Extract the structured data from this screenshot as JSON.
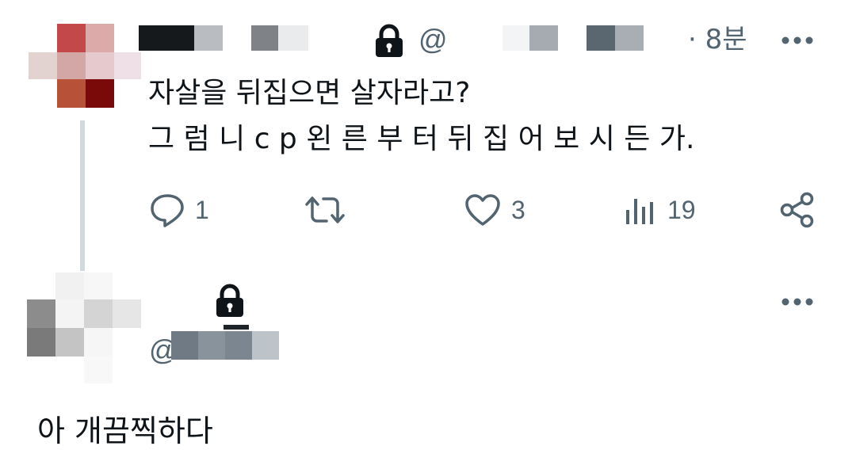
{
  "tweet": {
    "handle_prefix": "@",
    "timestamp": "· 8분",
    "lines": [
      "자살을 뒤집으면 살자라고?",
      "그 럼 니 c p 왼 른 부 터 뒤 집 어 보 시 든 가."
    ],
    "actions": {
      "reply_count": "1",
      "like_count": "3",
      "view_count": "19"
    },
    "icons": [
      "lock-icon",
      "more-icon",
      "reply-icon",
      "retweet-icon",
      "like-icon",
      "views-icon",
      "share-icon"
    ]
  },
  "reply": {
    "handle_prefix": "@",
    "body": "아 개끔찍하다",
    "icons": [
      "lock-icon",
      "more-icon"
    ]
  },
  "colors": {
    "text": "#0f1419",
    "muted": "#536471",
    "thread_line": "#cfd9de"
  }
}
